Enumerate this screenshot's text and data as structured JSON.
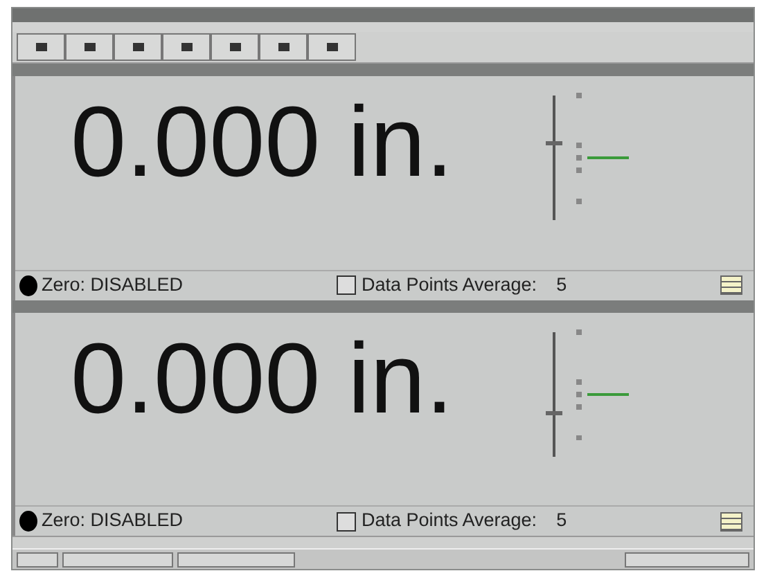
{
  "panels": [
    {
      "readout": "0.000 in.",
      "zero_status": "Zero: DISABLED",
      "average_label": "Data Points Average:",
      "average_value": "5",
      "level": 0.62
    },
    {
      "readout": "0.000 in.",
      "zero_status": "Zero: DISABLED",
      "average_label": "Data Points Average:",
      "average_value": "5",
      "level": 0.35
    }
  ]
}
